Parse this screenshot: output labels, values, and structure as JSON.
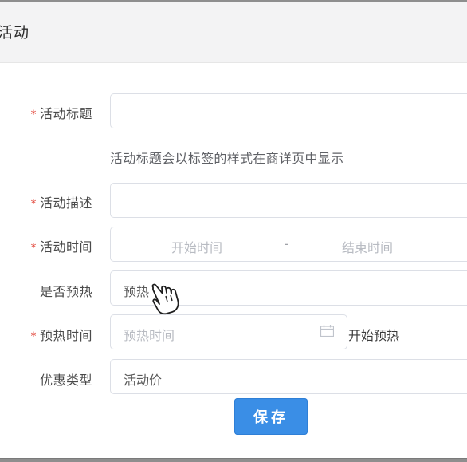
{
  "dialog": {
    "title": "活动"
  },
  "form": {
    "title_field": {
      "label": "活动标题",
      "value": "",
      "hint": "活动标题会以标签的样式在商详页中显示"
    },
    "desc_field": {
      "label": "活动描述",
      "value": ""
    },
    "time_field": {
      "label": "活动时间",
      "start_placeholder": "开始时间",
      "separator": "-",
      "end_placeholder": "结束时间"
    },
    "preheat_field": {
      "label": "是否预热",
      "value": "预热"
    },
    "preheat_time_field": {
      "label": "预热时间",
      "placeholder": "预热时间",
      "suffix": "开始预热"
    },
    "discount_type_field": {
      "label": "优惠类型",
      "value": "活动价"
    },
    "required_mark": "*"
  },
  "actions": {
    "save_label": "保存"
  },
  "icons": {
    "calendar": "calendar-icon",
    "cursor": "hand-pointer-icon"
  }
}
